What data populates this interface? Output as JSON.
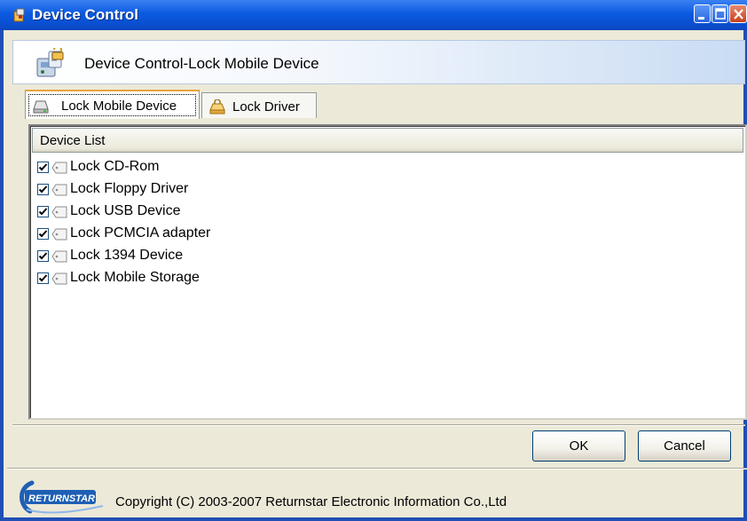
{
  "window": {
    "title": "Device Control",
    "icon": "app-icon",
    "controls": [
      "minimize-icon",
      "maximize-icon",
      "close-icon"
    ]
  },
  "header": {
    "title": "Device Control-Lock Mobile Device",
    "icon": "device-lock-icon"
  },
  "tabs": [
    {
      "label": "Lock Mobile Device",
      "icon": "drive-icon",
      "selected": true
    },
    {
      "label": "Lock Driver",
      "icon": "lock-drive-icon",
      "selected": false
    }
  ],
  "device_list": {
    "header": "Device List",
    "items": [
      {
        "label": "Lock CD-Rom",
        "checked": true
      },
      {
        "label": "Lock Floppy Driver",
        "checked": true
      },
      {
        "label": "Lock USB Device",
        "checked": true
      },
      {
        "label": "Lock PCMCIA adapter",
        "checked": true
      },
      {
        "label": "Lock 1394 Device",
        "checked": true
      },
      {
        "label": "Lock Mobile Storage",
        "checked": true
      }
    ]
  },
  "buttons": {
    "ok": "OK",
    "cancel": "Cancel"
  },
  "footer": {
    "logo_text": "RETURNSTAR",
    "copyright": "Copyright (C) 2003-2007 Returnstar Electronic Information Co.,Ltd"
  },
  "colors": {
    "titlebar": "#0A5AE0",
    "window_bg": "#ECE9D8",
    "tab_highlight": "#E8A33B"
  }
}
